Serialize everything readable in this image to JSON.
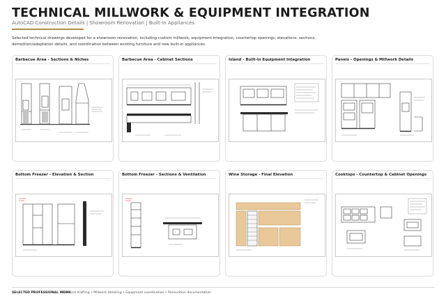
{
  "header": {
    "title": "TECHNICAL MILLWORK & EQUIPMENT INTEGRATION",
    "subtitle": "AutoCAD Construction Details | Showroom Renovation | Built-in Appliances",
    "accent_color": "#b08d57",
    "description": "Selected technical drawings developed for a showroom renovation, including custom millwork, equipment integration, countertop openings, elevations, sections, demolition/adaptation details, and coordination between existing furniture and new built-in appliances."
  },
  "cards": [
    {
      "title": "Barbecue Area - Sections & Niches"
    },
    {
      "title": "Barbecue Area - Cabinet Sections"
    },
    {
      "title": "Island - Built-in Equipment Integration"
    },
    {
      "title": "Panels - Openings & Millwork Details"
    },
    {
      "title": "Bottom Freezer - Elevation & Section"
    },
    {
      "title": "Bottom Freezer - Sections & Ventilation"
    },
    {
      "title": "Wine Storage - Final Elevation"
    },
    {
      "title": "Cooktops - Countertop & Cabinet Openings"
    }
  ],
  "footer": {
    "label": "SELECTED PROFESSIONAL WORK",
    "items": "Technical drafting • Millwork detailing • Equipment coordination • Renovation documentation"
  },
  "colors": {
    "drawing_line": "#3a3a3a",
    "wood_fill": "#e9c99a",
    "annotation_red": "#c0392b",
    "card_border": "#dcdcdc"
  }
}
